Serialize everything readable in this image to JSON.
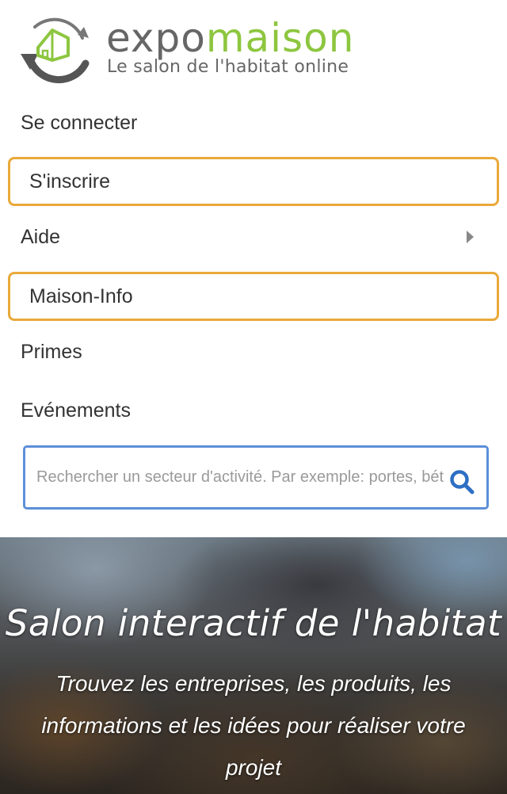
{
  "logo": {
    "word_part1": "expo",
    "word_part2": "maison",
    "tagline": "Le salon de l'habitat online",
    "colors": {
      "gray": "#666666",
      "green": "#8dc63f"
    }
  },
  "menu": {
    "items": [
      {
        "label": "Se connecter",
        "highlighted": false,
        "has_submenu": false
      },
      {
        "label": "S'inscrire",
        "highlighted": true,
        "has_submenu": false
      },
      {
        "label": "Aide",
        "highlighted": false,
        "has_submenu": true
      },
      {
        "label": "Maison-Info",
        "highlighted": true,
        "has_submenu": false
      },
      {
        "label": "Primes",
        "highlighted": false,
        "has_submenu": false
      },
      {
        "label": "Evénements",
        "highlighted": false,
        "has_submenu": false
      }
    ],
    "highlight_color": "#e9a93a"
  },
  "search": {
    "placeholder": "Rechercher un secteur d'activité. Par exemple: portes, bét",
    "value": "",
    "icon": "search-icon",
    "border_color": "#5c8fd8",
    "icon_color": "#2d6fc4"
  },
  "hero": {
    "title": "Salon interactif de l'habitat",
    "subtitle": "Trouvez les entreprises, les produits, les informations et les idées pour réaliser votre projet"
  }
}
